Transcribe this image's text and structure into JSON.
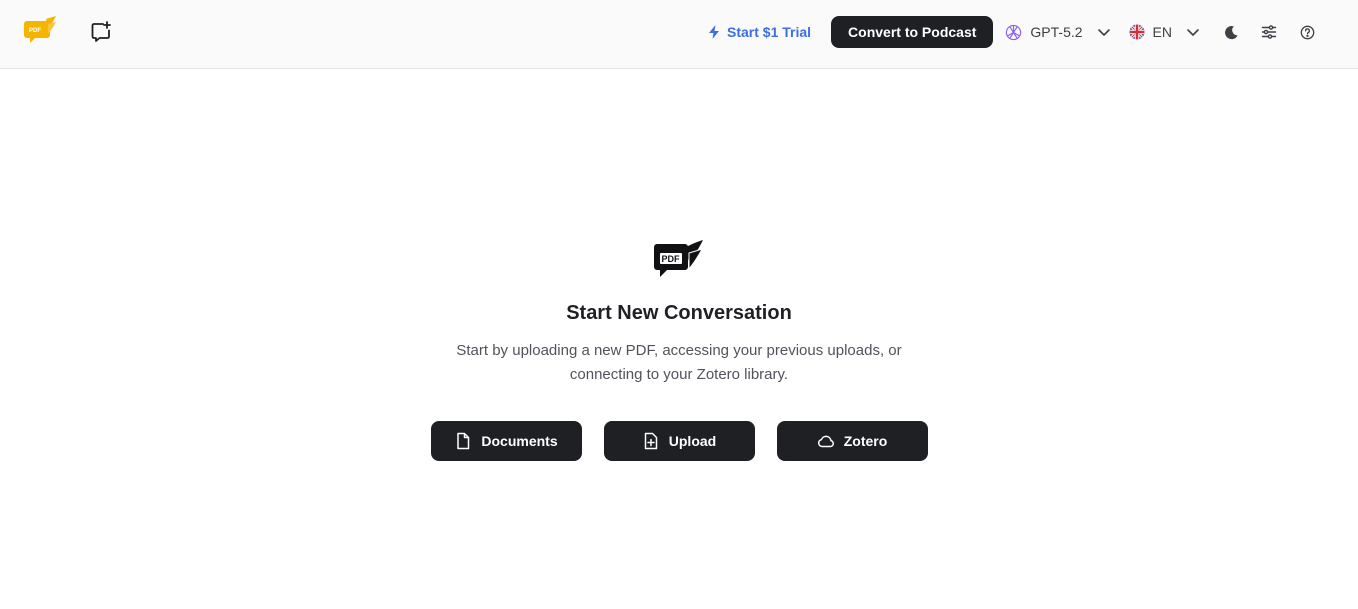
{
  "header": {
    "logo_icon": "pdf-chat-logo-icon",
    "new_chat_icon": "new-chat-icon",
    "trial_label": "Start $1 Trial",
    "podcast_label": "Convert to Podcast",
    "model_label": "GPT-5.2",
    "language_label": "EN",
    "colors": {
      "accent_blue": "#3b6fe0",
      "button_dark": "#1f2024",
      "logo_yellow": "#f5b400"
    }
  },
  "main": {
    "title": "Start New Conversation",
    "subtitle": "Start by uploading a new PDF, accessing your previous uploads, or connecting to your Zotero library.",
    "logo_text": "PDF",
    "buttons": {
      "documents": "Documents",
      "upload": "Upload",
      "zotero": "Zotero"
    }
  }
}
